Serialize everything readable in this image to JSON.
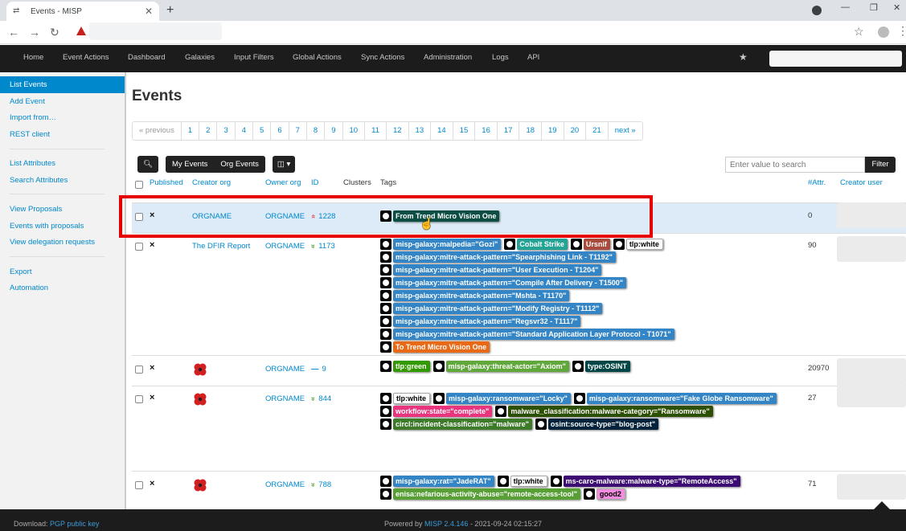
{
  "browser": {
    "tab_title": "Events - MISP",
    "tab_close": "✕",
    "new_tab": "+"
  },
  "topnav": {
    "items": [
      "Home",
      "Event Actions",
      "Dashboard",
      "Galaxies",
      "Input Filters",
      "Global Actions",
      "Sync Actions",
      "Administration",
      "Logs",
      "API"
    ]
  },
  "sidebar": {
    "items": [
      "List Events",
      "Add Event",
      "Import from…",
      "REST client",
      "List Attributes",
      "Search Attributes",
      "View Proposals",
      "Events with proposals",
      "View delegation requests",
      "Export",
      "Automation"
    ]
  },
  "main": {
    "title": "Events",
    "pagination": [
      "« previous",
      "1",
      "2",
      "3",
      "4",
      "5",
      "6",
      "7",
      "8",
      "9",
      "10",
      "11",
      "12",
      "13",
      "14",
      "15",
      "16",
      "17",
      "18",
      "19",
      "20",
      "21",
      "next »"
    ],
    "toolbar": {
      "my_events": "My Events",
      "org_events": "Org Events"
    },
    "search_placeholder": "Enter value to search",
    "filter_label": "Filter",
    "headers": {
      "published": "Published",
      "creator_org": "Creator org",
      "owner_org": "Owner org",
      "id": "ID",
      "clusters": "Clusters",
      "tags": "Tags",
      "attr": "#Attr.",
      "creator_user": "Creator user"
    },
    "events": [
      {
        "published": "×",
        "creator_org": "ORGNAME",
        "owner_org": "ORGNAME",
        "id_icon": "»",
        "id": "1228",
        "attr": "0",
        "tags": [
          [
            {
              "text": "From Trend Micro Vision One",
              "color": "#0c4e43",
              "fg": "#fff"
            }
          ]
        ]
      },
      {
        "published": "×",
        "creator_org": "The DFIR Report",
        "owner_org": "ORGNAME",
        "id_icon": "»",
        "id": "1173",
        "attr": "90",
        "tags": [
          [
            {
              "text": "misp-galaxy:malpedia=\"Gozi\"",
              "color": "#3385c6",
              "fg": "#fff"
            },
            {
              "text": "Cobalt Strike",
              "color": "#22a393",
              "fg": "#fff"
            },
            {
              "text": "Ursnif",
              "color": "#a84a3c",
              "fg": "#fff"
            },
            {
              "text": "tlp:white",
              "color": "#ffffff",
              "fg": "#000"
            }
          ],
          [
            {
              "text": "misp-galaxy:mitre-attack-pattern=\"Spearphishing Link - T1192\"",
              "color": "#3385c6",
              "fg": "#fff"
            }
          ],
          [
            {
              "text": "misp-galaxy:mitre-attack-pattern=\"User Execution - T1204\"",
              "color": "#3385c6",
              "fg": "#fff"
            }
          ],
          [
            {
              "text": "misp-galaxy:mitre-attack-pattern=\"Compile After Delivery - T1500\"",
              "color": "#3385c6",
              "fg": "#fff"
            }
          ],
          [
            {
              "text": "misp-galaxy:mitre-attack-pattern=\"Mshta - T1170\"",
              "color": "#3385c6",
              "fg": "#fff"
            }
          ],
          [
            {
              "text": "misp-galaxy:mitre-attack-pattern=\"Modify Registry - T1112\"",
              "color": "#3385c6",
              "fg": "#fff"
            }
          ],
          [
            {
              "text": "misp-galaxy:mitre-attack-pattern=\"Regsvr32 - T1117\"",
              "color": "#3385c6",
              "fg": "#fff"
            }
          ],
          [
            {
              "text": "misp-galaxy:mitre-attack-pattern=\"Standard Application Layer Protocol - T1071\"",
              "color": "#3385c6",
              "fg": "#fff"
            }
          ],
          [
            {
              "text": "To Trend Micro Vision One",
              "color": "#e86a17",
              "fg": "#fff"
            }
          ]
        ]
      },
      {
        "published": "×",
        "creator_org": "",
        "owner_org": "ORGNAME",
        "id_icon": "—",
        "id": "9",
        "attr": "20970",
        "tags": [
          [
            {
              "text": "tlp:green",
              "color": "#339900",
              "fg": "#fff"
            },
            {
              "text": "misp-galaxy:threat-actor=\"Axiom\"",
              "color": "#60a83b",
              "fg": "#fff"
            },
            {
              "text": "type:OSINT",
              "color": "#004646",
              "fg": "#fff"
            }
          ]
        ]
      },
      {
        "published": "×",
        "creator_org": "",
        "owner_org": "ORGNAME",
        "id_icon": "»",
        "id": "844",
        "attr": "27",
        "tags": [
          [
            {
              "text": "tlp:white",
              "color": "#ffffff",
              "fg": "#000"
            },
            {
              "text": "misp-galaxy:ransomware=\"Locky\"",
              "color": "#3385c6",
              "fg": "#fff"
            },
            {
              "text": "misp-galaxy:ransomware=\"Fake Globe Ransomware\"",
              "color": "#3385c6",
              "fg": "#fff"
            }
          ],
          [
            {
              "text": "workflow:state=\"complete\"",
              "color": "#e8357e",
              "fg": "#fff"
            },
            {
              "text": "malware_classification:malware-category=\"Ransomware\"",
              "color": "#2c4f00",
              "fg": "#fff"
            }
          ],
          [
            {
              "text": "circl:incident-classification=\"malware\"",
              "color": "#3d7a29",
              "fg": "#fff"
            },
            {
              "text": "osint:source-type=\"blog-post\"",
              "color": "#00223b",
              "fg": "#fff"
            }
          ]
        ]
      },
      {
        "published": "×",
        "creator_org": "",
        "owner_org": "ORGNAME",
        "id_icon": "»",
        "id": "788",
        "attr": "71",
        "tags": [
          [
            {
              "text": "misp-galaxy:rat=\"JadeRAT\"",
              "color": "#3385c6",
              "fg": "#fff"
            },
            {
              "text": "tlp:white",
              "color": "#ffffff",
              "fg": "#000"
            },
            {
              "text": "ms-caro-malware:malware-type=\"RemoteAccess\"",
              "color": "#3c0c74",
              "fg": "#fff"
            }
          ],
          [
            {
              "text": "enisa:nefarious-activity-abuse=\"remote-access-tool\"",
              "color": "#58a036",
              "fg": "#fff"
            },
            {
              "text": "good2",
              "color": "#f48de0",
              "fg": "#000"
            }
          ]
        ]
      }
    ]
  },
  "footer": {
    "download": "Download:",
    "pgp": "PGP public key",
    "powered_by": "Powered by",
    "misp_version": "MISP 2.4.146",
    "timestamp": "- 2021-09-24 02:15:27"
  }
}
